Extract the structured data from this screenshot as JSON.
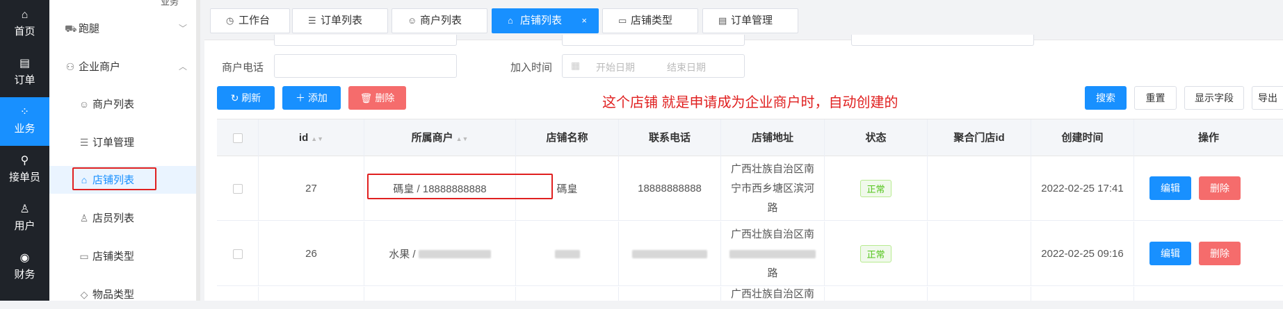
{
  "nav": {
    "items": [
      {
        "label": "首页",
        "icon": "home-icon"
      },
      {
        "label": "订单",
        "icon": "order-icon"
      },
      {
        "label": "业务",
        "icon": "business-icon"
      },
      {
        "label": "接单员",
        "icon": "bike-icon"
      },
      {
        "label": "用户",
        "icon": "user-icon"
      },
      {
        "label": "财务",
        "icon": "finance-icon"
      }
    ],
    "active": "业务"
  },
  "submenu": {
    "top_label": "业务",
    "items": [
      {
        "label": "跑腿",
        "icon": "errand-icon",
        "level": 1
      },
      {
        "label": "企业商户",
        "icon": "merchant-icon",
        "level": 1
      },
      {
        "label": "商户列表",
        "icon": "merchant-list-icon",
        "level": 2
      },
      {
        "label": "订单管理",
        "icon": "order-manage-icon",
        "level": 2
      },
      {
        "label": "店铺列表",
        "icon": "shop-icon",
        "level": 2
      },
      {
        "label": "店员列表",
        "icon": "clerk-icon",
        "level": 2
      },
      {
        "label": "店铺类型",
        "icon": "shop-type-icon",
        "level": 2
      },
      {
        "label": "物品类型",
        "icon": "goods-type-icon",
        "level": 2
      }
    ],
    "active": "店铺列表"
  },
  "tabs": [
    {
      "label": "工作台",
      "icon": "dashboard-icon"
    },
    {
      "label": "订单列表",
      "icon": "list-icon"
    },
    {
      "label": "商户列表",
      "icon": "user-circle-icon"
    },
    {
      "label": "店铺列表",
      "icon": "shop-icon",
      "active": true,
      "close": "×"
    },
    {
      "label": "店铺类型",
      "icon": "card-icon"
    },
    {
      "label": "订单管理",
      "icon": "doc-icon"
    }
  ],
  "filters": {
    "phone_label": "商户电话",
    "phone_value": "",
    "join_label": "加入时间",
    "start_placeholder": "开始日期",
    "end_placeholder": "结束日期"
  },
  "toolbar": {
    "refresh": "刷新",
    "add": "添加",
    "delete": "删除",
    "search": "搜索",
    "reset": "重置",
    "show_fields": "显示字段",
    "export": "导出"
  },
  "annotation": "这个店铺 就是申请成为企业商户时，自动创建的",
  "table": {
    "headers": [
      "id",
      "所属商户",
      "店铺名称",
      "联系电话",
      "店铺地址",
      "状态",
      "聚合门店id",
      "创建时间",
      "操作"
    ],
    "rows": [
      {
        "id": "27",
        "merchant": "碼皇 / 18888888888",
        "shop_name": "碼皇",
        "phone": "18888888888",
        "address": "广西壮族自治区南宁市西乡塘区滨河路",
        "status": "正常",
        "agg_id": "",
        "created": "2022-02-25 17:41",
        "edit": "编辑",
        "del": "删除"
      },
      {
        "id": "26",
        "merchant": "水果 /",
        "shop_name": "",
        "phone": "",
        "address_l1": "广西壮族自治区南",
        "address_l3": "路",
        "status": "正常",
        "agg_id": "",
        "created": "2022-02-25 09:16",
        "edit": "编辑",
        "del": "删除"
      },
      {
        "address_l1": "广西壮族自治区南"
      }
    ]
  },
  "colors": {
    "primary": "#1890ff",
    "danger": "#f56c6c",
    "annotation": "#e02020",
    "nav_bg": "#1f2329"
  }
}
